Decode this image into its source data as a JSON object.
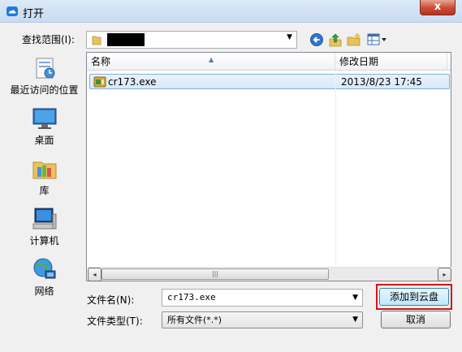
{
  "window": {
    "title": "打开",
    "close_label": "x"
  },
  "toolbar": {
    "look_in_label": "查找范围(I):",
    "icons": [
      "back-icon",
      "up-folder-icon",
      "new-folder-icon",
      "view-menu-icon"
    ]
  },
  "places": [
    {
      "label": "最近访问的位置",
      "icon": "recent-places-icon"
    },
    {
      "label": "桌面",
      "icon": "desktop-icon"
    },
    {
      "label": "库",
      "icon": "library-icon"
    },
    {
      "label": "计算机",
      "icon": "computer-icon"
    },
    {
      "label": "网络",
      "icon": "network-icon"
    }
  ],
  "file_list": {
    "columns": [
      "名称",
      "修改日期"
    ],
    "rows": [
      {
        "name": "cr173.exe",
        "modified": "2013/8/23 17:45",
        "selected": true
      }
    ],
    "scroll_left": "◂",
    "scroll_right": "▸",
    "scroll_grip": "|||"
  },
  "footer": {
    "file_name_label": "文件名(N):",
    "file_name_value": "cr173.exe",
    "file_type_label": "文件类型(T):",
    "file_type_value": "所有文件(*.*)",
    "open_button": "添加到云盘",
    "cancel_button": "取消"
  },
  "colors": {
    "highlight_border": "#d21515",
    "selection_bg": "#d9e9f9"
  }
}
